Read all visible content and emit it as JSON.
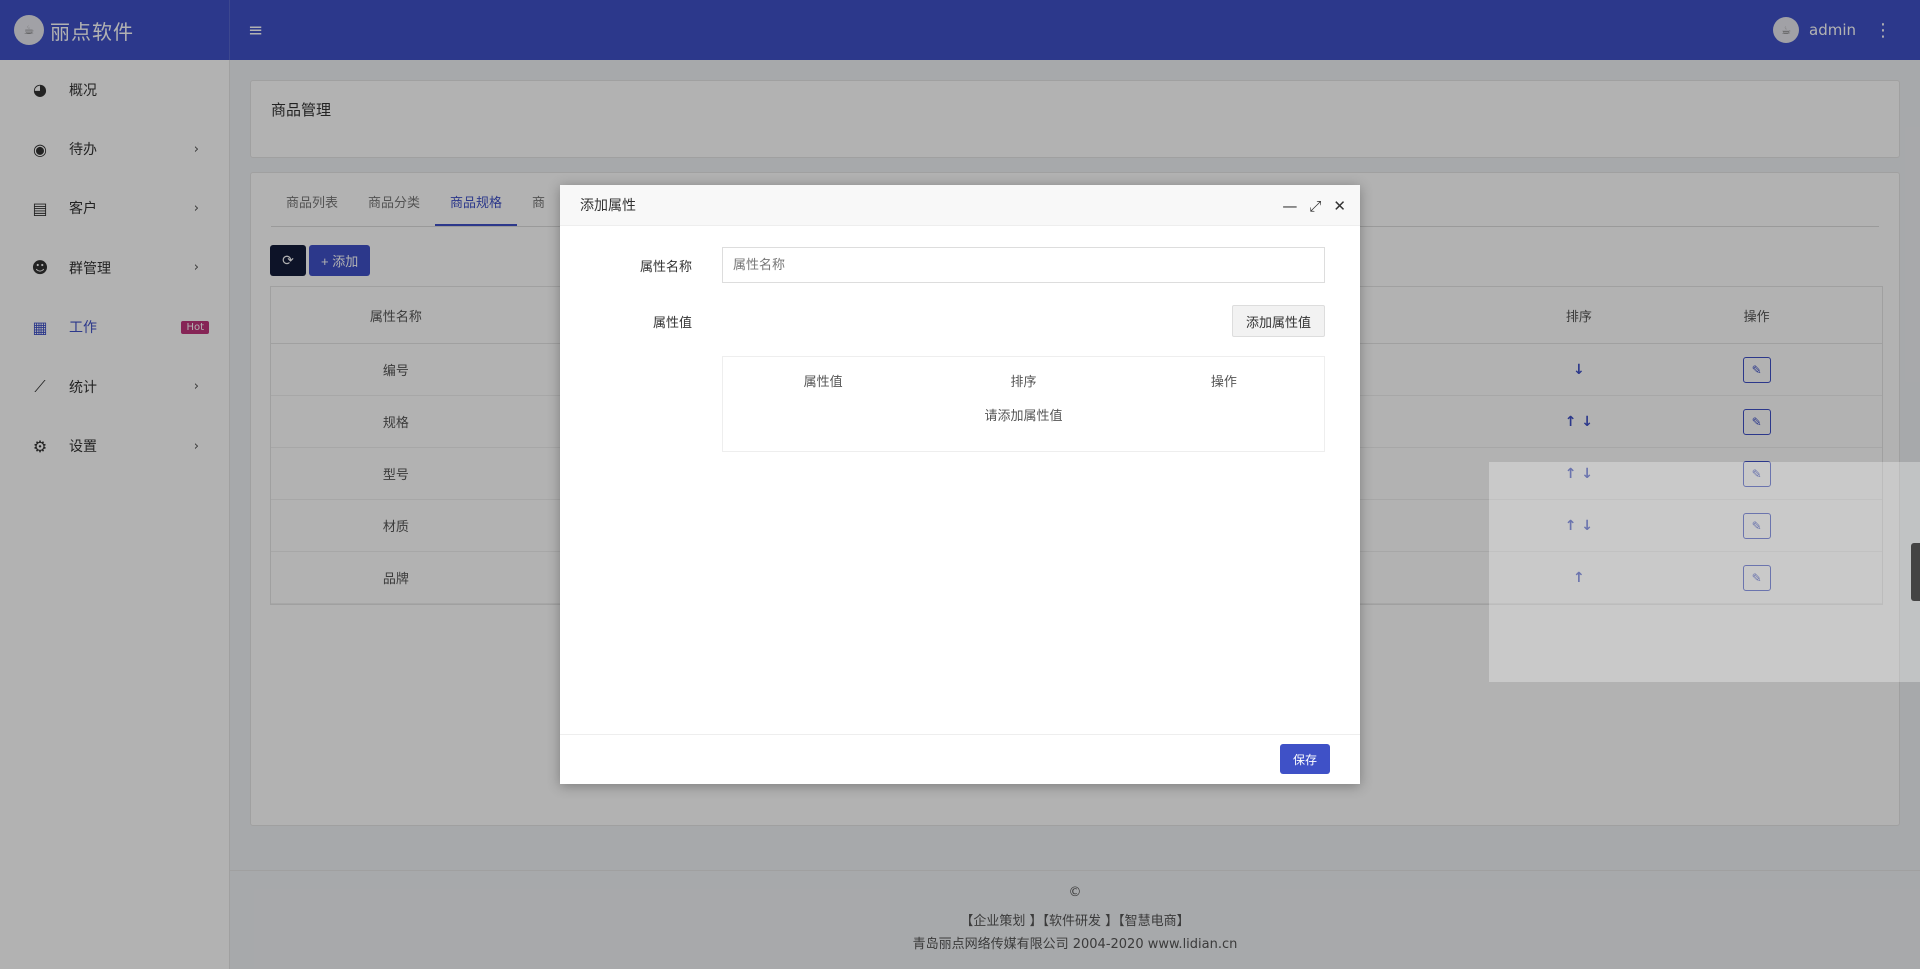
{
  "app": {
    "brand": "丽点软件",
    "logo_text": "☕",
    "user": "admin"
  },
  "sidebar": {
    "items": [
      {
        "label": "概况",
        "icon": "dashboard-icon",
        "glyph": "◕",
        "chevron": ""
      },
      {
        "label": "待办",
        "icon": "compass-icon",
        "glyph": "◉",
        "chevron": "›"
      },
      {
        "label": "客户",
        "icon": "id-card-icon",
        "glyph": "▤",
        "chevron": "›"
      },
      {
        "label": "群管理",
        "icon": "users-icon",
        "glyph": "☻",
        "chevron": "›"
      },
      {
        "label": "工作",
        "icon": "grid-icon",
        "glyph": "▦",
        "badge": "Hot",
        "chevron": ""
      },
      {
        "label": "统计",
        "icon": "chart-line-icon",
        "glyph": "⟋",
        "chevron": "›"
      },
      {
        "label": "设置",
        "icon": "gear-icon",
        "glyph": "⚙",
        "chevron": "›"
      }
    ]
  },
  "page": {
    "title": "商品管理"
  },
  "tabs": [
    "商品列表",
    "商品分类",
    "商品规格",
    "商"
  ],
  "toolbar": {
    "refresh_glyph": "⟳",
    "add_label": "+ 添加"
  },
  "table": {
    "headers": [
      "属性名称",
      "",
      "排序",
      "操作"
    ],
    "rows": [
      {
        "name": "编号",
        "sort": "↓"
      },
      {
        "name": "规格",
        "sort": "↑ ↓"
      },
      {
        "name": "型号",
        "sort": "↑ ↓"
      },
      {
        "name": "材质",
        "sort": "↑ ↓"
      },
      {
        "name": "品牌",
        "sort": "↑"
      }
    ],
    "edit_glyph": "✎"
  },
  "footer": {
    "copyright": "©",
    "links": "【企业策划 】【软件研发 】【智慧电商】",
    "company": "青岛丽点网络传媒有限公司 2004-2020 www.lidian.cn"
  },
  "dialog": {
    "title": "添加属性",
    "minimize": "—",
    "maximize": "⤢",
    "close": "✕",
    "name_label": "属性名称",
    "name_placeholder": "属性名称",
    "value_label": "属性值",
    "add_value_button": "添加属性值",
    "value_table": {
      "headers": [
        "属性值",
        "排序",
        "操作"
      ],
      "empty": "请添加属性值"
    },
    "save_button": "保存"
  },
  "colors": {
    "primary": "#3f51c7",
    "hot": "#c0357c",
    "dark": "#131c3a"
  }
}
